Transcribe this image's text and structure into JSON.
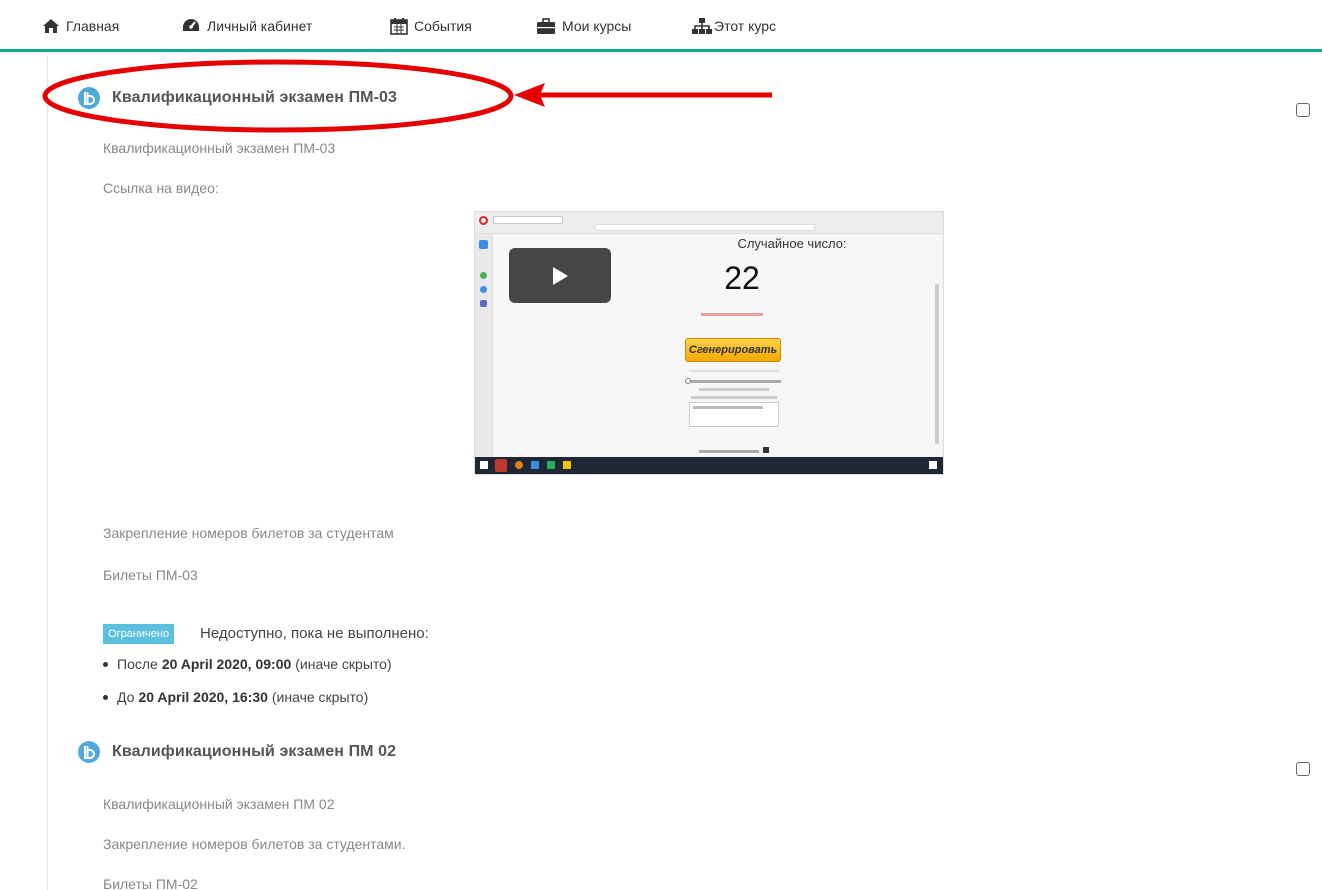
{
  "nav": {
    "home": "Главная",
    "dashboard": "Личный кабинет",
    "events": "События",
    "my_courses": "Мои курсы",
    "this_course": "Этот курс"
  },
  "activity1": {
    "title": "Квалификационный экзамен ПМ-03",
    "description": "Квалификационный экзамен ПМ-03",
    "video_label": "Ссылка на видео:",
    "assign_link": "Закрепление номеров билетов за студентам",
    "tickets_link": "Билеты ПМ-03"
  },
  "video": {
    "heading": "Случайное число:",
    "number": "22",
    "button": "Сгенерировать"
  },
  "restriction": {
    "badge": "Ограничено",
    "text": "Недоступно, пока не выполнено:",
    "cond1_prefix": "После",
    "cond1_date": "20 April 2020, 09:00",
    "cond1_suffix": "(иначе скрыто)",
    "cond2_prefix": "До",
    "cond2_date": "20 April 2020, 16:30",
    "cond2_suffix": "(иначе скрыто)"
  },
  "activity2": {
    "title": "Квалификационный экзамен ПМ 02",
    "description": "Квалификационный экзамен ПМ 02",
    "assign_link": "Закрепление номеров билетов за студентами.",
    "tickets_link": "Билеты ПМ-02"
  },
  "colors": {
    "accent": "#1aa68e",
    "icon_blue": "#52a8dc",
    "badge": "#5bc0de",
    "annotation_red": "#e60000"
  }
}
